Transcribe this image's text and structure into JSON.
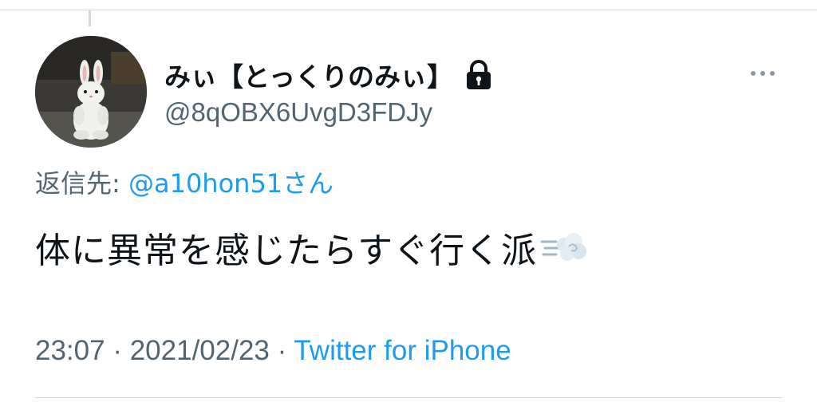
{
  "tweet": {
    "display_name": "みぃ【とっくりのみぃ】",
    "handle": "@8qOBX6UvgD3FDJy",
    "protected_icon": "lock-icon",
    "more_icon": "more-dots-icon",
    "reply_label": "返信先: ",
    "reply_mention": "@a10hon51さん",
    "text": "体に異常を感じたらすぐ行く派",
    "text_emoji": "dash-symbol-emoji",
    "time": "23:07",
    "separator": " · ",
    "date": "2021/02/23",
    "source": "Twitter for iPhone"
  },
  "colors": {
    "primary_text": "#0f1419",
    "secondary_text": "#536471",
    "link": "#1d9bf0",
    "divider": "#cfd9de"
  }
}
